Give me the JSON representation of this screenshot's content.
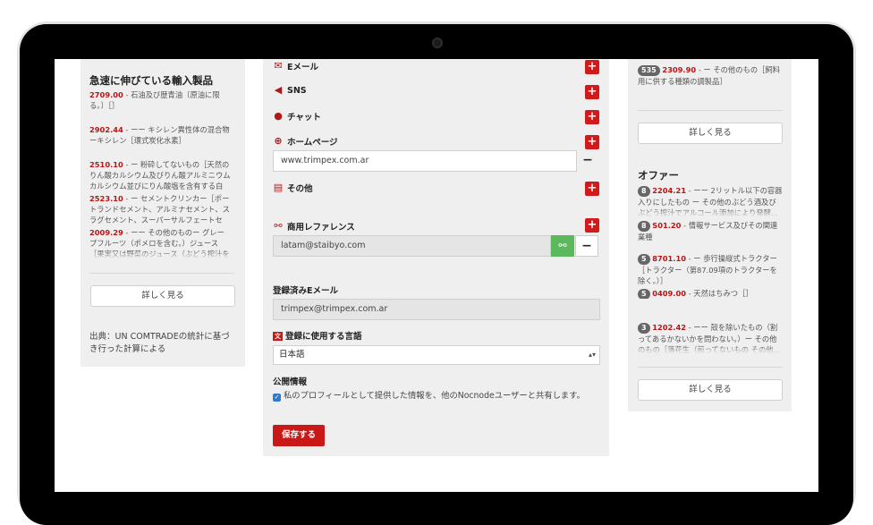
{
  "left": {
    "title": "急速に伸びている輸入製品",
    "items": [
      {
        "code": "2709.00",
        "text": " - 石油及び歴青油〔原油に限る。〕［］"
      },
      {
        "code": "2902.44",
        "text": " - ーー キシレン異性体の混合物ーキシレン［環式炭化水素］"
      },
      {
        "code": "2510.10",
        "text": " - ー 粉砕してないもの［天然のりん酸カルシウム及びりん酸アルミニウムカルシウム並びにりん酸塩を含有する白亜］"
      },
      {
        "code": "2523.10",
        "text": " - ー セメントクリンカー［ポートランドセメント、アルミナセメント、スラグセメント、スーパーサルフェートセメ..."
      },
      {
        "code": "2009.29",
        "text": " - ーー その他のものー グレープフルーツ（ポメロを含む。）ジュース［果実又は野菜のジュース（ぶどう搾汁を含..."
      }
    ],
    "more_label": "詳しく見る",
    "source": "出典：UN COMTRADEの統計に基づき行った計算による"
  },
  "form": {
    "email_label": "Eメール",
    "sns_label": "SNS",
    "chat_label": "チャット",
    "homepage_label": "ホームページ",
    "homepage_value": "www.trimpex.com.ar",
    "other_label": "その他",
    "reference_label": "商用レファレンス",
    "reference_value": "latam@staibyo.com",
    "registered_email_label": "登録済みEメール",
    "registered_email_value": "trimpex@trimpex.com.ar",
    "language_icon": "文",
    "language_label": "登録に使用する言語",
    "language_value": "日本語",
    "public_label": "公開情報",
    "public_text": "私のプロフィールとして提供した情報を、他のNocnodeユーザーと共有します。",
    "save_label": "保存する",
    "plus": "+",
    "minus": "−"
  },
  "right": {
    "top_item": {
      "badge": "535",
      "code": "2309.90",
      "text": " - ー その他のもの［飼料用に供する種類の調製品］"
    },
    "more_label_1": "詳しく見る",
    "offers_title": "オファー",
    "offers": [
      {
        "badge": "8",
        "code": "2204.21",
        "text": " - ーー 2リットル以下の容器入りにしたもの ー その他のぶどう酒及びぶどう搾汁でアルコール添加により発酵..."
      },
      {
        "badge": "8",
        "code": "S01.20",
        "text": " - 情報サービス及びその関連業種"
      },
      {
        "badge": "5",
        "code": "8701.10",
        "text": " - ー 歩行操縦式トラクター［トラクター（第87.09項のトラクターを除く。）］"
      },
      {
        "badge": "5",
        "code": "0409.00",
        "text": " - 天然はちみつ［］"
      },
      {
        "badge": "3",
        "code": "1202.42",
        "text": " - ーー 殻を除いたもの（割ってあるかないかを問わない。）ー その他のもの［落花生（煎ってないもの その他..."
      }
    ],
    "more_label_2": "詳しく見る"
  }
}
